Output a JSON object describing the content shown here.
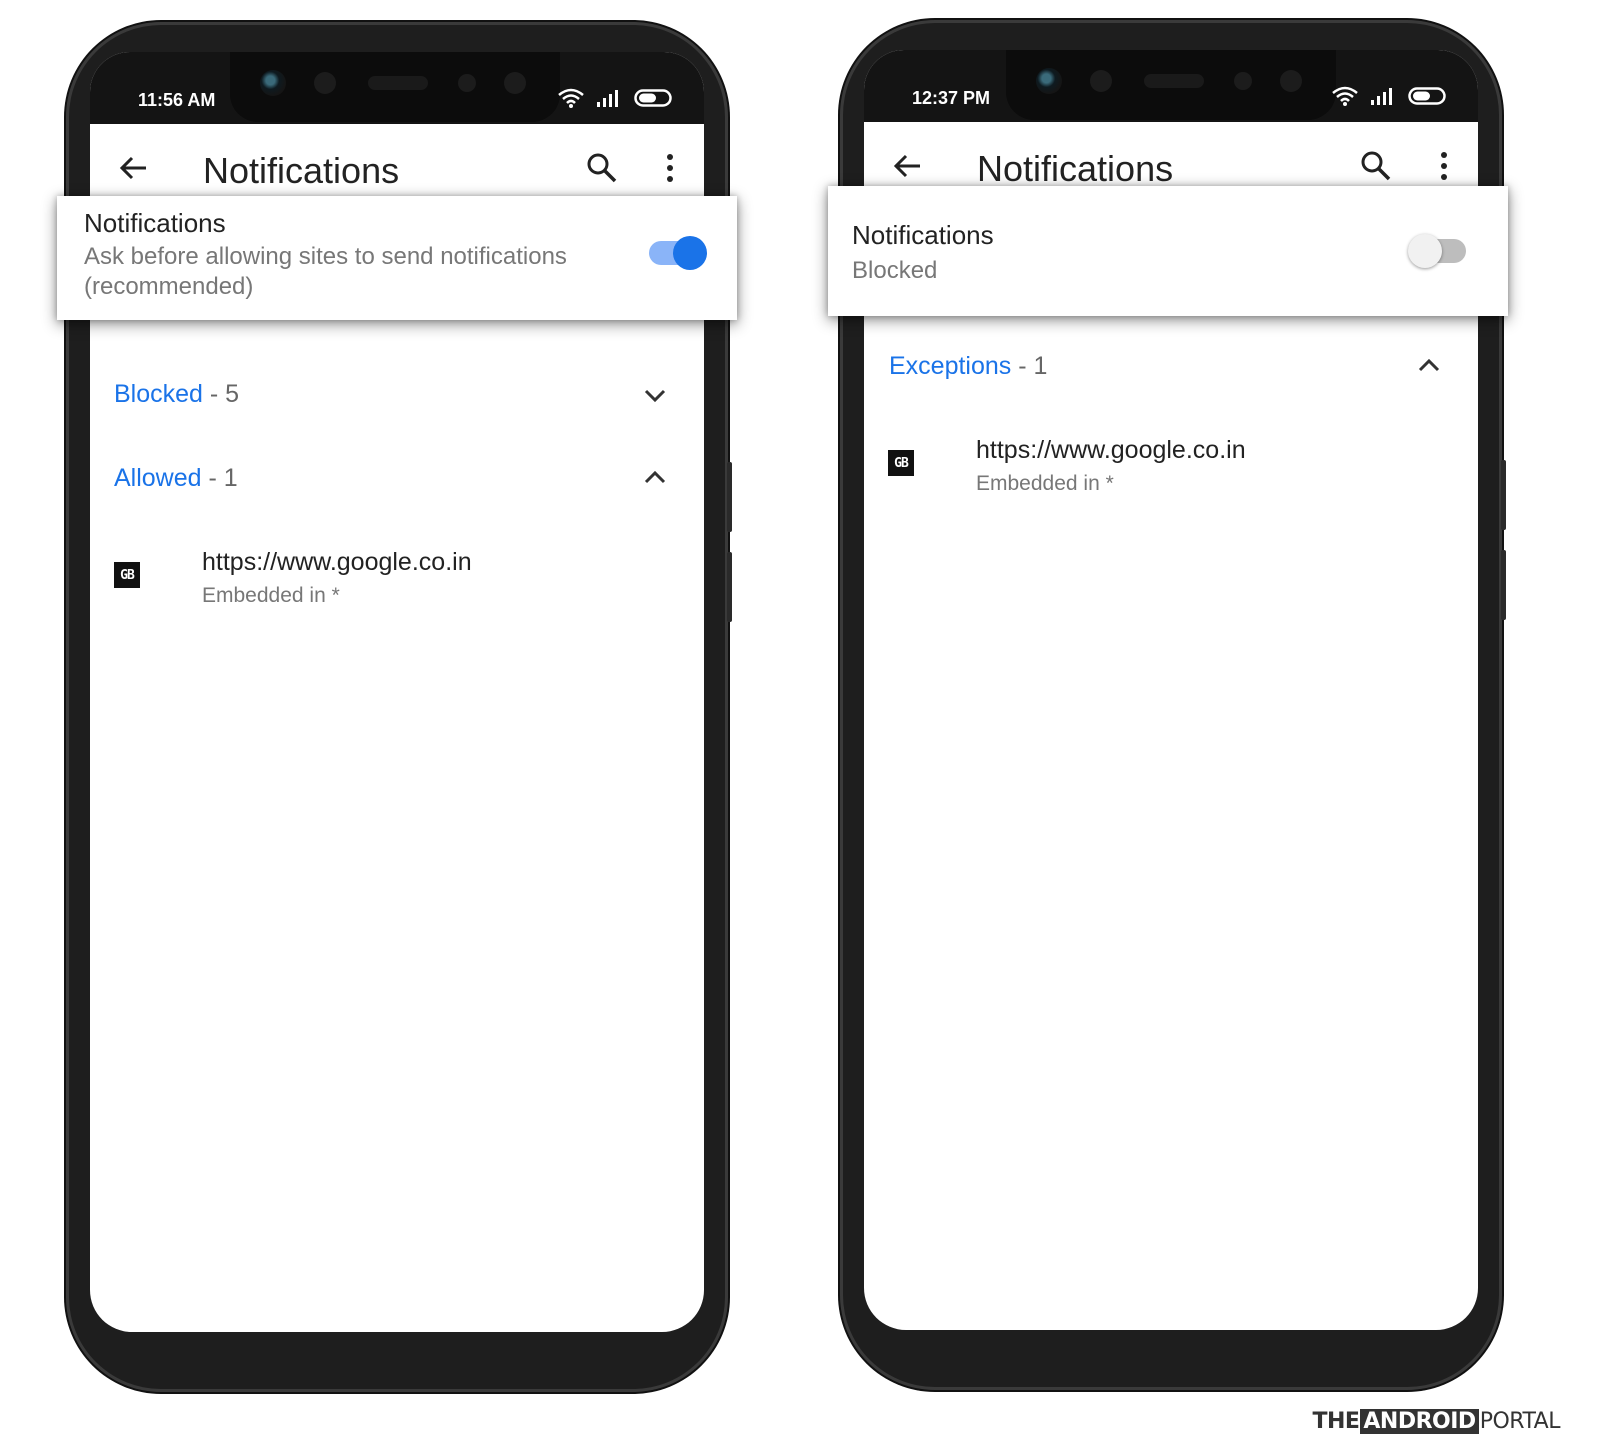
{
  "left_phone": {
    "status_time": "11:56 AM",
    "app_title": "Notifications",
    "card": {
      "title": "Notifications",
      "subtitle_line1": "Ask before allowing sites to send notifications",
      "subtitle_line2": "(recommended)",
      "toggle_on": true
    },
    "sections": [
      {
        "label": "Blocked",
        "count": "- 5",
        "expanded": false
      },
      {
        "label": "Allowed",
        "count": "- 1",
        "expanded": true
      }
    ],
    "site": {
      "url": "https://www.google.co.in",
      "detail": "Embedded in *",
      "icon_text": "GB"
    }
  },
  "right_phone": {
    "status_time": "12:37 PM",
    "app_title": "Notifications",
    "card": {
      "title": "Notifications",
      "subtitle_line1": "Blocked",
      "toggle_on": false
    },
    "sections": [
      {
        "label": "Exceptions",
        "count": "- 1",
        "expanded": true
      }
    ],
    "site": {
      "url": "https://www.google.co.in",
      "detail": "Embedded in *",
      "icon_text": "GB"
    }
  },
  "watermark": {
    "part1": "THE",
    "part2": "ANDROID",
    "part3": "PORTAL"
  },
  "colors": {
    "accent": "#1a73e8",
    "toggle_track_on": "#8ab4f8",
    "toggle_off_knob": "#f1f1f1",
    "toggle_off_track": "#bdbdbd"
  }
}
